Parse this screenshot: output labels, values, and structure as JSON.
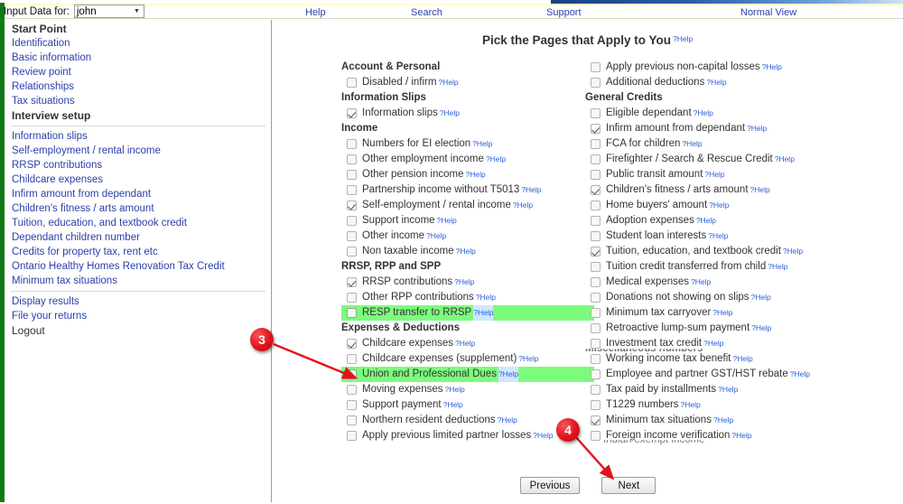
{
  "topbar": {
    "input_label": "Input Data for:",
    "selected_user": "john",
    "dropdown_arrow": "chevron-down-icon",
    "links": [
      {
        "label": "Help"
      },
      {
        "label": "Search"
      },
      {
        "label": "Support"
      },
      {
        "label": "Normal View"
      }
    ]
  },
  "sidebar": {
    "sections": [
      {
        "items": [
          {
            "label": "Start Point",
            "style": "head"
          },
          {
            "label": "Identification",
            "style": "link"
          },
          {
            "label": "Basic information",
            "style": "link"
          },
          {
            "label": "Review point",
            "style": "link"
          },
          {
            "label": "Relationships",
            "style": "link"
          },
          {
            "label": "Tax situations",
            "style": "link"
          },
          {
            "label": "Interview setup",
            "style": "head"
          }
        ]
      },
      {
        "items": [
          {
            "label": "Information slips",
            "style": "link"
          },
          {
            "label": "Self-employment / rental income",
            "style": "link"
          },
          {
            "label": "RRSP contributions",
            "style": "link"
          },
          {
            "label": "Childcare expenses",
            "style": "link"
          },
          {
            "label": "Infirm amount from dependant",
            "style": "link"
          },
          {
            "label": "Children's fitness / arts amount",
            "style": "link"
          },
          {
            "label": "Tuition, education, and textbook credit",
            "style": "link"
          },
          {
            "label": "Dependant children number",
            "style": "link"
          },
          {
            "label": "Credits for property tax, rent etc",
            "style": "link"
          },
          {
            "label": "Ontario Healthy Homes Renovation Tax Credit",
            "style": "link"
          },
          {
            "label": "Minimum tax situations",
            "style": "link"
          }
        ]
      },
      {
        "items": [
          {
            "label": "Display results",
            "style": "link"
          },
          {
            "label": "File your returns",
            "style": "link"
          },
          {
            "label": "Logout",
            "style": "logout"
          }
        ]
      }
    ]
  },
  "main": {
    "title": "Pick the Pages that Apply to You",
    "title_help": "?Help",
    "help_label": "?Help",
    "middle_column": [
      {
        "kind": "heading",
        "label": "Account & Personal"
      },
      {
        "kind": "check",
        "label": "Disabled / infirm",
        "checked": false,
        "highlight": false
      },
      {
        "kind": "heading",
        "label": "Information Slips"
      },
      {
        "kind": "check",
        "label": "Information slips",
        "checked": true,
        "highlight": false
      },
      {
        "kind": "heading",
        "label": "Income"
      },
      {
        "kind": "check",
        "label": "Numbers for EI election",
        "checked": false,
        "highlight": false
      },
      {
        "kind": "check",
        "label": "Other employment income",
        "checked": false,
        "highlight": false
      },
      {
        "kind": "check",
        "label": "Other pension income",
        "checked": false,
        "highlight": false
      },
      {
        "kind": "check",
        "label": "Partnership income without T5013",
        "checked": false,
        "highlight": false
      },
      {
        "kind": "check",
        "label": "Self-employment / rental income",
        "checked": true,
        "highlight": false
      },
      {
        "kind": "check",
        "label": "Support income",
        "checked": false,
        "highlight": false
      },
      {
        "kind": "check",
        "label": "Other income",
        "checked": false,
        "highlight": false
      },
      {
        "kind": "check",
        "label": "Non taxable income",
        "checked": false,
        "highlight": false
      },
      {
        "kind": "heading",
        "label": "RRSP, RPP and SPP"
      },
      {
        "kind": "check",
        "label": "RRSP contributions",
        "checked": true,
        "highlight": false
      },
      {
        "kind": "check",
        "label": "Other RPP contributions",
        "checked": false,
        "highlight": false
      },
      {
        "kind": "check",
        "label": "RESP transfer to RRSP",
        "checked": false,
        "highlight": true
      },
      {
        "kind": "heading",
        "label": "Expenses & Deductions"
      },
      {
        "kind": "check",
        "label": "Childcare expenses",
        "checked": true,
        "highlight": false
      },
      {
        "kind": "check",
        "label": "Childcare expenses (supplement)",
        "checked": false,
        "highlight": false
      },
      {
        "kind": "check",
        "label": "Union and Professional Dues",
        "checked": false,
        "highlight": true
      },
      {
        "kind": "check",
        "label": "Moving expenses",
        "checked": false,
        "highlight": false
      },
      {
        "kind": "check",
        "label": "Support payment",
        "checked": false,
        "highlight": false
      },
      {
        "kind": "check",
        "label": "Northern resident deductions",
        "checked": false,
        "highlight": false
      },
      {
        "kind": "check",
        "label": "Apply previous limited partner losses",
        "checked": false,
        "highlight": false
      }
    ],
    "right_column": [
      {
        "kind": "check",
        "label": "Apply previous non-capital losses",
        "checked": false,
        "highlight": false
      },
      {
        "kind": "check",
        "label": "Additional deductions",
        "checked": false,
        "highlight": false
      },
      {
        "kind": "heading",
        "label": "General Credits"
      },
      {
        "kind": "check",
        "label": "Eligible dependant",
        "checked": false,
        "highlight": false
      },
      {
        "kind": "check",
        "label": "Infirm amount from dependant",
        "checked": true,
        "highlight": false
      },
      {
        "kind": "check",
        "label": "FCA for children",
        "checked": false,
        "highlight": false
      },
      {
        "kind": "check",
        "label": "Firefighter / Search & Rescue Credit",
        "checked": false,
        "highlight": false
      },
      {
        "kind": "check",
        "label": "Public transit amount",
        "checked": false,
        "highlight": false
      },
      {
        "kind": "check",
        "label": "Children's fitness / arts amount",
        "checked": true,
        "highlight": false
      },
      {
        "kind": "check",
        "label": "Home buyers' amount",
        "checked": false,
        "highlight": false
      },
      {
        "kind": "check",
        "label": "Adoption expenses",
        "checked": false,
        "highlight": false
      },
      {
        "kind": "check",
        "label": "Student loan interests",
        "checked": false,
        "highlight": false
      },
      {
        "kind": "check",
        "label": "Tuition, education, and textbook credit",
        "checked": true,
        "highlight": false
      },
      {
        "kind": "check",
        "label": "Tuition credit transferred from child",
        "checked": false,
        "highlight": false
      },
      {
        "kind": "check",
        "label": "Medical expenses",
        "checked": false,
        "highlight": false
      },
      {
        "kind": "check",
        "label": "Donations not showing on slips",
        "checked": false,
        "highlight": false
      },
      {
        "kind": "check",
        "label": "Minimum tax carryover",
        "checked": false,
        "highlight": false
      },
      {
        "kind": "check",
        "label": "Retroactive lump-sum payment",
        "checked": false,
        "highlight": false
      },
      {
        "kind": "check",
        "label": "Investment tax credit",
        "checked": false,
        "highlight": false
      },
      {
        "kind": "check",
        "label": "Working income tax benefit",
        "checked": false,
        "highlight": false
      },
      {
        "kind": "check",
        "label": "Employee and partner GST/HST rebate",
        "checked": false,
        "highlight": false
      },
      {
        "kind": "check",
        "label": "Tax paid by installments",
        "checked": false,
        "highlight": false
      },
      {
        "kind": "check",
        "label": "T1229 numbers",
        "checked": false,
        "highlight": false
      },
      {
        "kind": "check",
        "label": "Minimum tax situations",
        "checked": true,
        "highlight": false
      },
      {
        "kind": "check",
        "label": "Foreign income verification",
        "checked": false,
        "highlight": false
      }
    ],
    "ghost_texts": {
      "misc_heading": "Miscellaneous numbers",
      "indian_exempt": "Indian exempt income"
    },
    "buttons": {
      "previous": "Previous",
      "next": "Next"
    }
  },
  "annotations": [
    {
      "label": "3",
      "target": "Union and Professional Dues checkbox"
    },
    {
      "label": "4",
      "target": "Next button"
    }
  ],
  "colors": {
    "highlight_green": "#7dfb7d",
    "link_blue": "#2b3faa",
    "help_blue": "#2b5fd9",
    "annotation_red": "#e2121b",
    "sidebar_green_bar": "#0f7a16"
  }
}
